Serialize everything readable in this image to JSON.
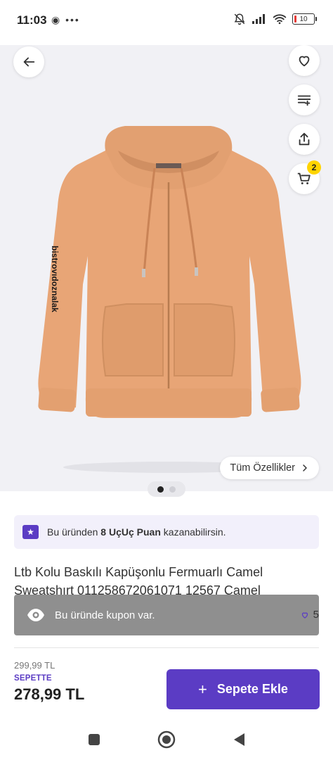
{
  "status_bar": {
    "time": "11:03",
    "left_icons": "◉ •••",
    "battery_level": "10"
  },
  "product_image": {
    "sleeve_print_text": "bistrovıdoznalak"
  },
  "floating_buttons": {
    "cart_count": "2"
  },
  "features_button": {
    "label": "Tüm Özellikler"
  },
  "carousel": {
    "page_count": 2,
    "active_index": 0
  },
  "points_banner": {
    "prefix": "Bu üründen ",
    "points": "8 UçUç Puan",
    "suffix": " kazanabilirsin."
  },
  "product": {
    "title": "Ltb Kolu Baskılı Kapüşonlu Fermuarlı Camel Sweatshırt 011258672061071 12567 Camel"
  },
  "coupon_toast": {
    "text": "Bu üründe kupon var."
  },
  "favorites": {
    "count": "5"
  },
  "price": {
    "old_price": "299,99 TL",
    "cart_label": "SEPETTE",
    "new_price": "278,99 TL"
  },
  "cart_button": {
    "label": "Sepete Ekle"
  },
  "colors": {
    "accent": "#5b3cc4",
    "badge": "#ffd400",
    "hoodie": "#e8a576"
  }
}
